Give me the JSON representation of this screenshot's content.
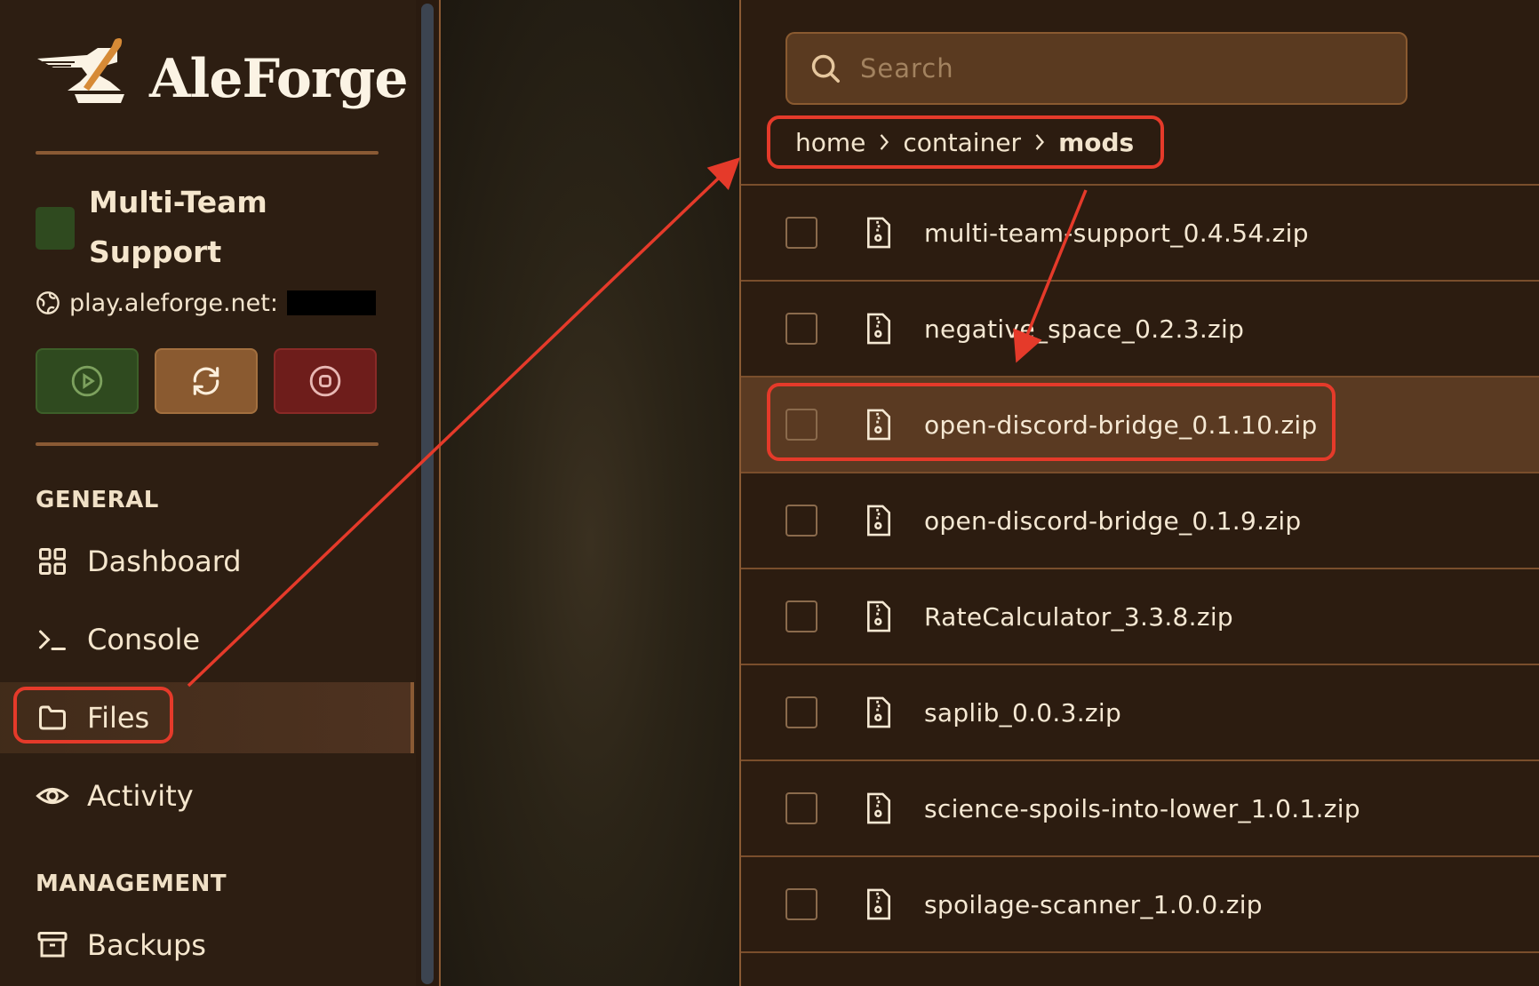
{
  "brand": {
    "name": "AleForge"
  },
  "server": {
    "name": "Multi-Team Support",
    "address": "play.aleforge.net:",
    "status_color": "#2f4a1f"
  },
  "controls": [
    {
      "name": "start",
      "icon": "play-circle-icon",
      "color": "#2f4a1f"
    },
    {
      "name": "restart",
      "icon": "refresh-icon",
      "color": "#8a5a30"
    },
    {
      "name": "stop",
      "icon": "stop-circle-icon",
      "color": "#6e1d1b"
    }
  ],
  "sidebar": {
    "general_title": "GENERAL",
    "items": [
      {
        "label": "Dashboard",
        "icon": "dashboard-grid-icon"
      },
      {
        "label": "Console",
        "icon": "terminal-icon"
      },
      {
        "label": "Files",
        "icon": "folder-icon",
        "active": true
      },
      {
        "label": "Activity",
        "icon": "eye-icon"
      }
    ],
    "management_title": "MANAGEMENT",
    "management_items": [
      {
        "label": "Backups",
        "icon": "archive-icon"
      }
    ]
  },
  "files": {
    "search_placeholder": "Search",
    "breadcrumb": [
      "home",
      "container",
      "mods"
    ],
    "rows": [
      {
        "name": "multi-team-support_0.4.54.zip"
      },
      {
        "name": "negative_space_0.2.3.zip"
      },
      {
        "name": "open-discord-bridge_0.1.10.zip",
        "highlighted": true
      },
      {
        "name": "open-discord-bridge_0.1.9.zip"
      },
      {
        "name": "RateCalculator_3.3.8.zip"
      },
      {
        "name": "saplib_0.0.3.zip"
      },
      {
        "name": "science-spoils-into-lower_1.0.1.zip"
      },
      {
        "name": "spoilage-scanner_1.0.0.zip"
      }
    ]
  },
  "colors": {
    "accent": "#8a5a34",
    "annotation": "#e53a2a"
  }
}
